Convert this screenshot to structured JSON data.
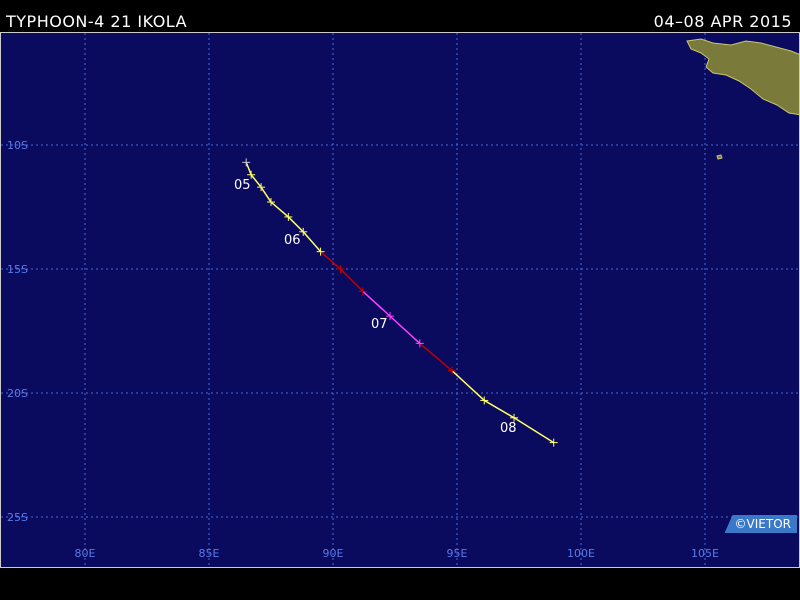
{
  "header": {
    "title": "TYPHOON-4 21 IKOLA",
    "date_range": "04–08 APR 2015"
  },
  "map": {
    "lat_labels": [
      "10S",
      "15S",
      "20S",
      "25S"
    ],
    "lon_labels": [
      "80E",
      "85E",
      "90E",
      "95E",
      "100E",
      "105E"
    ],
    "credit": "©VIETOR",
    "colors": {
      "ocean": "#0a0a5e",
      "land": "#7a7a3a",
      "grid": "#4a6ad8",
      "track_depression": "#c8c8c8",
      "track_storm": "#ffff66",
      "track_typhoon1": "#c00000",
      "track_typhoon2": "#ff40ff"
    }
  },
  "track": {
    "day_labels": [
      "05",
      "06",
      "07",
      "08"
    ],
    "points": [
      {
        "lon": 86.5,
        "lat": -10.7,
        "cat": "depression"
      },
      {
        "lon": 86.7,
        "lat": -11.2,
        "cat": "storm"
      },
      {
        "lon": 87.1,
        "lat": -11.7,
        "cat": "storm"
      },
      {
        "lon": 87.5,
        "lat": -12.3,
        "cat": "storm"
      },
      {
        "lon": 88.2,
        "lat": -12.9,
        "cat": "storm"
      },
      {
        "lon": 88.8,
        "lat": -13.5,
        "cat": "storm"
      },
      {
        "lon": 89.5,
        "lat": -14.3,
        "cat": "storm"
      },
      {
        "lon": 90.3,
        "lat": -15.0,
        "cat": "typhoon1"
      },
      {
        "lon": 91.2,
        "lat": -15.9,
        "cat": "typhoon1"
      },
      {
        "lon": 92.3,
        "lat": -16.9,
        "cat": "typhoon2"
      },
      {
        "lon": 93.5,
        "lat": -18.0,
        "cat": "typhoon2"
      },
      {
        "lon": 94.8,
        "lat": -19.1,
        "cat": "typhoon1"
      },
      {
        "lon": 96.1,
        "lat": -20.3,
        "cat": "storm"
      },
      {
        "lon": 97.3,
        "lat": -21.0,
        "cat": "storm"
      },
      {
        "lon": 98.9,
        "lat": -22.0,
        "cat": "storm"
      }
    ]
  }
}
